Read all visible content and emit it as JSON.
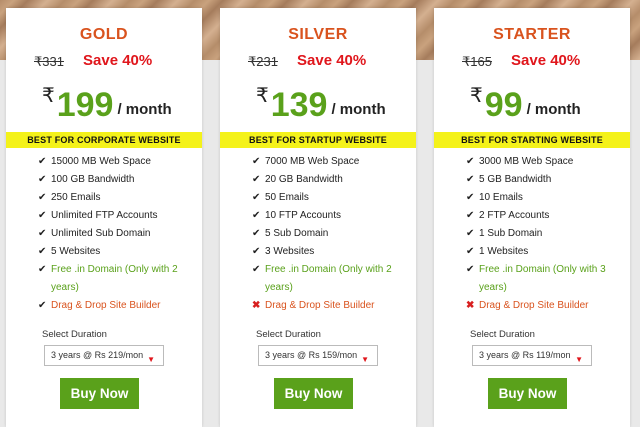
{
  "plans": [
    {
      "name": "GOLD",
      "old_price": "₹331",
      "save": "Save 40%",
      "currency": "₹",
      "price": "199",
      "per": "/ month",
      "banner": "BEST FOR CORPORATE WEBSITE",
      "features": [
        {
          "text": "15000 MB Web Space",
          "mark": "✔",
          "style": "tick"
        },
        {
          "text": "100 GB Bandwidth",
          "mark": "✔",
          "style": "tick"
        },
        {
          "text": "250 Emails",
          "mark": "✔",
          "style": "tick"
        },
        {
          "text": "Unlimited FTP Accounts",
          "mark": "✔",
          "style": "tick"
        },
        {
          "text": "Unlimited Sub Domain",
          "mark": "✔",
          "style": "tick"
        },
        {
          "text": "5 Websites",
          "mark": "✔",
          "style": "tick"
        },
        {
          "text": "Free .in Domain (Only with 2 years)",
          "mark": "✔",
          "style": "tick green"
        },
        {
          "text": "Drag & Drop Site Builder",
          "mark": "✔",
          "style": "tick orange"
        }
      ],
      "duration_label": "Select Duration",
      "duration_value": "3 years @ Rs 219/mon",
      "buy_label": "Buy Now"
    },
    {
      "name": "SILVER",
      "old_price": "₹231",
      "save": "Save 40%",
      "currency": "₹",
      "price": "139",
      "per": "/ month",
      "banner": "BEST FOR STARTUP WEBSITE",
      "features": [
        {
          "text": "7000 MB Web Space",
          "mark": "✔",
          "style": "tick"
        },
        {
          "text": "20 GB Bandwidth",
          "mark": "✔",
          "style": "tick"
        },
        {
          "text": "50 Emails",
          "mark": "✔",
          "style": "tick"
        },
        {
          "text": "10 FTP Accounts",
          "mark": "✔",
          "style": "tick"
        },
        {
          "text": "5 Sub Domain",
          "mark": "✔",
          "style": "tick"
        },
        {
          "text": "3 Websites",
          "mark": "✔",
          "style": "tick"
        },
        {
          "text": "Free .in Domain (Only with 2 years)",
          "mark": "✔",
          "style": "tick green"
        },
        {
          "text": "Drag & Drop Site Builder",
          "mark": "✖",
          "style": "cross orange"
        }
      ],
      "duration_label": "Select Duration",
      "duration_value": "3 years @ Rs 159/mon",
      "buy_label": "Buy Now"
    },
    {
      "name": "STARTER",
      "old_price": "₹165",
      "save": "Save 40%",
      "currency": "₹",
      "price": "99",
      "per": "/ month",
      "banner": "BEST FOR STARTING WEBSITE",
      "features": [
        {
          "text": "3000 MB Web Space",
          "mark": "✔",
          "style": "tick"
        },
        {
          "text": "5 GB Bandwidth",
          "mark": "✔",
          "style": "tick"
        },
        {
          "text": "10 Emails",
          "mark": "✔",
          "style": "tick"
        },
        {
          "text": "2 FTP Accounts",
          "mark": "✔",
          "style": "tick"
        },
        {
          "text": "1 Sub Domain",
          "mark": "✔",
          "style": "tick"
        },
        {
          "text": "1 Websites",
          "mark": "✔",
          "style": "tick"
        },
        {
          "text": "Free .in Domain (Only with 3 years)",
          "mark": "✔",
          "style": "tick green"
        },
        {
          "text": "Drag & Drop Site Builder",
          "mark": "✖",
          "style": "cross orange"
        }
      ],
      "duration_label": "Select Duration",
      "duration_value": "3 years @ Rs 119/mon",
      "buy_label": "Buy Now"
    }
  ],
  "icons": {
    "caret": "chevron-down-icon",
    "tick": "check-icon",
    "cross": "cross-icon"
  },
  "colors": {
    "accent_green": "#5aa11b",
    "plan_orange": "#d9531e",
    "save_red": "#e0161c",
    "banner_yellow": "#f4f21a"
  }
}
